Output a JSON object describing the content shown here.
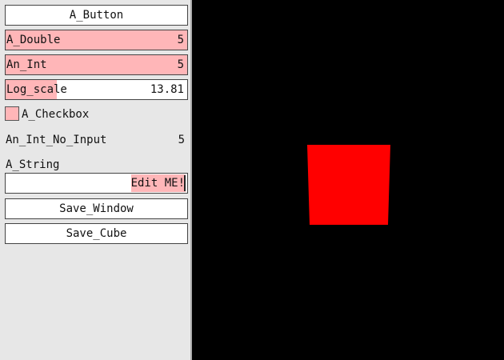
{
  "controls": {
    "a_button_label": "A_Button",
    "a_double": {
      "label": "A_Double",
      "value": "5",
      "fill_fraction": 1.0
    },
    "an_int": {
      "label": "An_Int",
      "value": "5",
      "fill_fraction": 1.0
    },
    "log_scale": {
      "label": "Log_scale",
      "value": "13.81",
      "fill_fraction": 0.28
    },
    "checkbox": {
      "label": "A_Checkbox",
      "checked": false
    },
    "an_int_no_input": {
      "label": "An_Int_No_Input",
      "value": "5"
    },
    "a_string": {
      "label": "A_String",
      "value": "Edit ME!"
    },
    "save_window_label": "Save_Window",
    "save_cube_label": "Save_Cube"
  },
  "viewport": {
    "background_color": "#000000",
    "cube_color": "#ff0000"
  },
  "colors": {
    "panel_bg": "#e7e7e7",
    "highlight": "#ffb6b8"
  }
}
